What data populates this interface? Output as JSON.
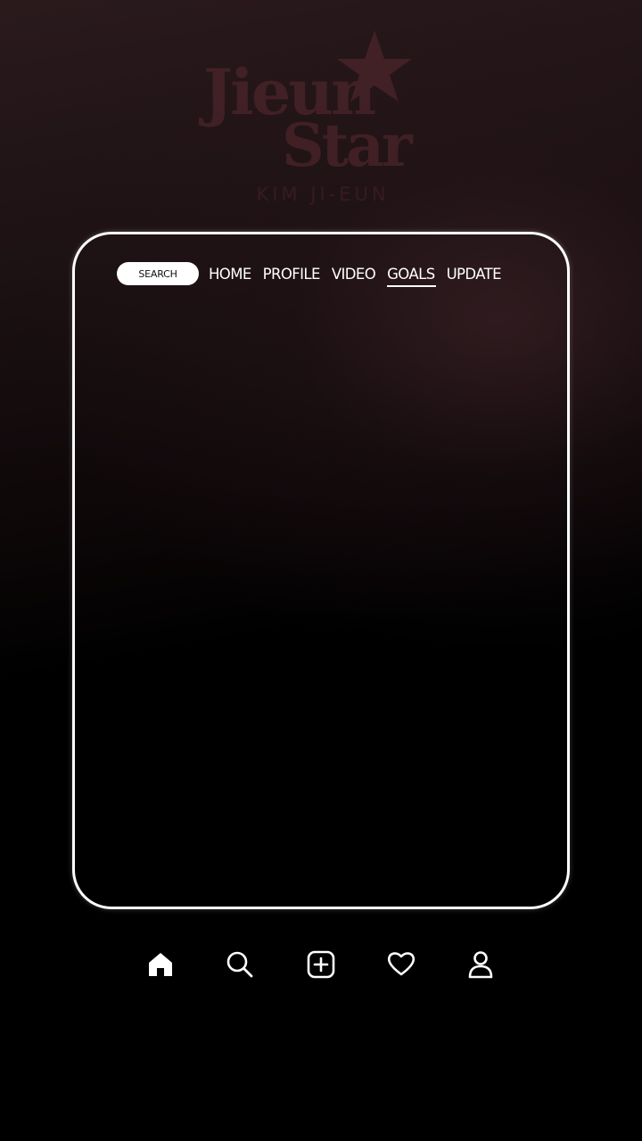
{
  "logo": {
    "line1": "Jieun",
    "line2": "Star",
    "subtitle": "KIM JI-EUN",
    "color": "#5a2a32"
  },
  "nav": {
    "search_label": "SEARCH",
    "items": [
      {
        "label": "HOME",
        "active": false
      },
      {
        "label": "PROFILE",
        "active": false
      },
      {
        "label": "VIDEO",
        "active": false
      },
      {
        "label": "GOALS",
        "active": true
      },
      {
        "label": "UPDATE",
        "active": false
      }
    ]
  },
  "bottom_bar": {
    "icons": [
      "home-icon",
      "search-icon",
      "add-icon",
      "heart-icon",
      "profile-icon"
    ]
  },
  "colors": {
    "frame": "#ffffff",
    "text": "#ffffff",
    "background": "#000000"
  }
}
